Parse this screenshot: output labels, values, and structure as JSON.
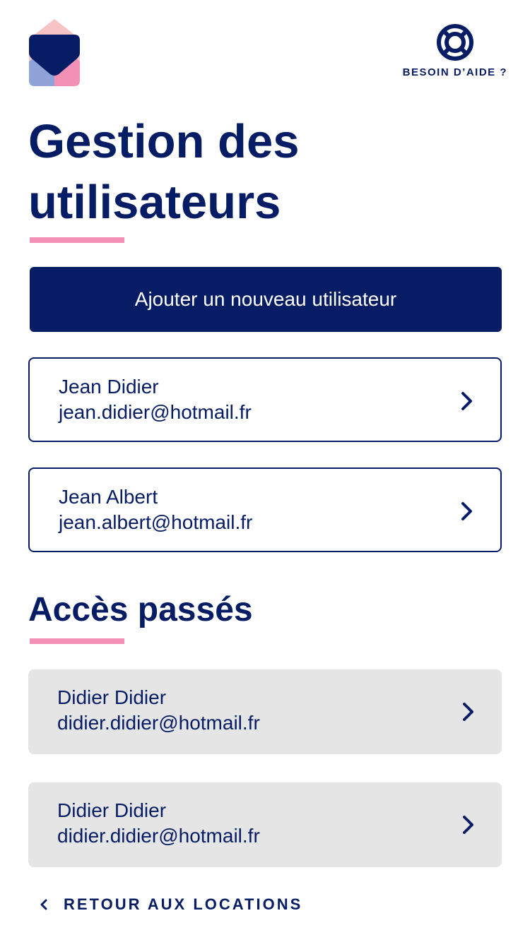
{
  "brand": {
    "logo_icon": "house-heart-logo",
    "colors": {
      "navy": "#061c64",
      "pink": "#f291b5",
      "light_pink": "#f8c3c6",
      "periwinkle": "#8fa3d8"
    }
  },
  "help": {
    "icon": "lifebuoy-icon",
    "label": "BESOIN D’AIDE ?"
  },
  "page": {
    "title": "Gestion des utilisateurs"
  },
  "actions": {
    "add_user_label": "Ajouter un nouveau utilisateur"
  },
  "users": [
    {
      "name": "Jean Didier",
      "email": "jean.didier@hotmail.fr"
    },
    {
      "name": "Jean Albert",
      "email": "jean.albert@hotmail.fr"
    }
  ],
  "past_access": {
    "title": "Accès passés",
    "users": [
      {
        "name": "Didier Didier",
        "email": "didier.didier@hotmail.fr"
      },
      {
        "name": "Didier Didier",
        "email": "didier.didier@hotmail.fr"
      }
    ]
  },
  "footer": {
    "back_icon": "chevron-left-icon",
    "back_label": "RETOUR AUX LOCATIONS"
  }
}
